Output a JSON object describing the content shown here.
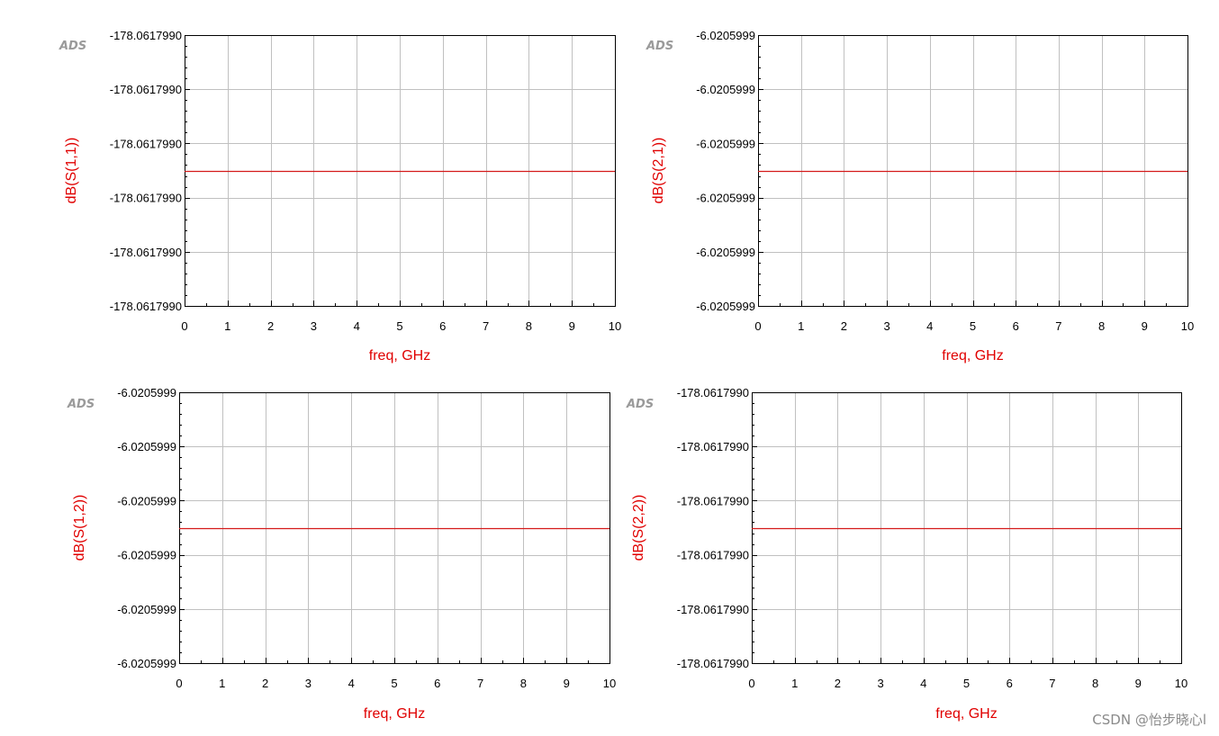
{
  "watermark": "CSDN @怡步晓心l",
  "chart_data": [
    {
      "type": "line",
      "logo": "ADS",
      "xlabel": "freq, GHz",
      "ylabel": "dB(S(1,1))",
      "xlim": [
        0,
        10
      ],
      "x_ticks": [
        "0",
        "1",
        "2",
        "3",
        "4",
        "5",
        "6",
        "7",
        "8",
        "9",
        "10"
      ],
      "y_tick_labels": [
        "-178.0617990",
        "-178.0617990",
        "-178.0617990",
        "-178.0617990",
        "-178.0617990",
        "-178.0617990"
      ],
      "series": [
        {
          "x": [
            0,
            10
          ],
          "y_fraction_of_range": 0.5,
          "value": -178.061799,
          "color": "#d41a1a"
        }
      ],
      "grid": true
    },
    {
      "type": "line",
      "logo": "ADS",
      "xlabel": "freq, GHz",
      "ylabel": "dB(S(2,1))",
      "xlim": [
        0,
        10
      ],
      "x_ticks": [
        "0",
        "1",
        "2",
        "3",
        "4",
        "5",
        "6",
        "7",
        "8",
        "9",
        "10"
      ],
      "y_tick_labels": [
        "-6.0205999",
        "-6.0205999",
        "-6.0205999",
        "-6.0205999",
        "-6.0205999",
        "-6.0205999"
      ],
      "series": [
        {
          "x": [
            0,
            10
          ],
          "y_fraction_of_range": 0.5,
          "value": -6.0205999,
          "color": "#d41a1a"
        }
      ],
      "grid": true
    },
    {
      "type": "line",
      "logo": "ADS",
      "xlabel": "freq, GHz",
      "ylabel": "dB(S(1,2))",
      "xlim": [
        0,
        10
      ],
      "x_ticks": [
        "0",
        "1",
        "2",
        "3",
        "4",
        "5",
        "6",
        "7",
        "8",
        "9",
        "10"
      ],
      "y_tick_labels": [
        "-6.0205999",
        "-6.0205999",
        "-6.0205999",
        "-6.0205999",
        "-6.0205999",
        "-6.0205999"
      ],
      "series": [
        {
          "x": [
            0,
            10
          ],
          "y_fraction_of_range": 0.5,
          "value": -6.0205999,
          "color": "#d41a1a"
        }
      ],
      "grid": true
    },
    {
      "type": "line",
      "logo": "ADS",
      "xlabel": "freq, GHz",
      "ylabel": "dB(S(2,2))",
      "xlim": [
        0,
        10
      ],
      "x_ticks": [
        "0",
        "1",
        "2",
        "3",
        "4",
        "5",
        "6",
        "7",
        "8",
        "9",
        "10"
      ],
      "y_tick_labels": [
        "-178.0617990",
        "-178.0617990",
        "-178.0617990",
        "-178.0617990",
        "-178.0617990",
        "-178.0617990"
      ],
      "series": [
        {
          "x": [
            0,
            10
          ],
          "y_fraction_of_range": 0.5,
          "value": -178.061799,
          "color": "#d41a1a"
        }
      ],
      "grid": true
    }
  ]
}
